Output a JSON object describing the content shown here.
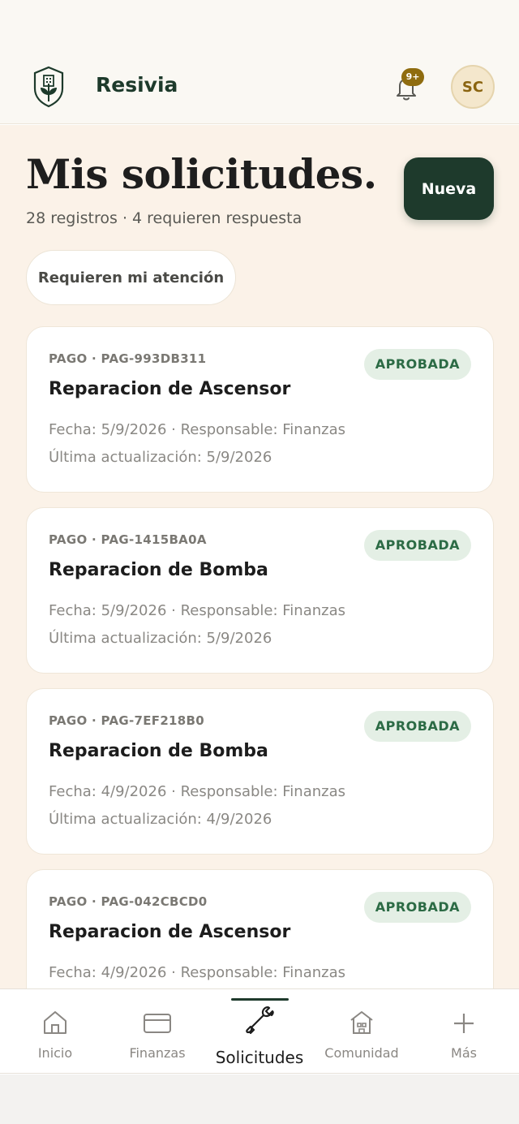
{
  "header": {
    "brand": "Resivia",
    "notification_badge": "9+",
    "avatar_initials": "SC"
  },
  "page": {
    "title": "Mis solicitudes.",
    "subtitle": "28 registros · 4 requieren respuesta",
    "new_button_label": "Nueva",
    "filter_chip_label": "Requieren mi atención"
  },
  "requests": [
    {
      "meta": "PAGO · PAG-993DB311",
      "title": "Reparacion de Ascensor",
      "status": "APROBADA",
      "line1": "Fecha: 5/9/2026 · Responsable: Finanzas",
      "line2": "Última actualización: 5/9/2026"
    },
    {
      "meta": "PAGO · PAG-1415BA0A",
      "title": "Reparacion de Bomba",
      "status": "APROBADA",
      "line1": "Fecha: 5/9/2026 · Responsable: Finanzas",
      "line2": "Última actualización: 5/9/2026"
    },
    {
      "meta": "PAGO · PAG-7EF218B0",
      "title": "Reparacion de Bomba",
      "status": "APROBADA",
      "line1": "Fecha: 4/9/2026 · Responsable: Finanzas",
      "line2": "Última actualización: 4/9/2026"
    },
    {
      "meta": "PAGO · PAG-042CBCD0",
      "title": "Reparacion de Ascensor",
      "status": "APROBADA",
      "line1": "Fecha: 4/9/2026 · Responsable: Finanzas",
      "line2": ""
    }
  ],
  "nav": [
    {
      "label": "Inicio",
      "icon": "home-icon"
    },
    {
      "label": "Finanzas",
      "icon": "card-icon"
    },
    {
      "label": "Solicitudes",
      "icon": "wrench-icon",
      "active": true
    },
    {
      "label": "Comunidad",
      "icon": "building-icon"
    },
    {
      "label": "Más",
      "icon": "plus-icon"
    }
  ],
  "colors": {
    "brand_green": "#1e3a2c",
    "background": "#fbf2e8",
    "status_green": "#2c6b45",
    "badge_gold": "#8f6c0f"
  }
}
